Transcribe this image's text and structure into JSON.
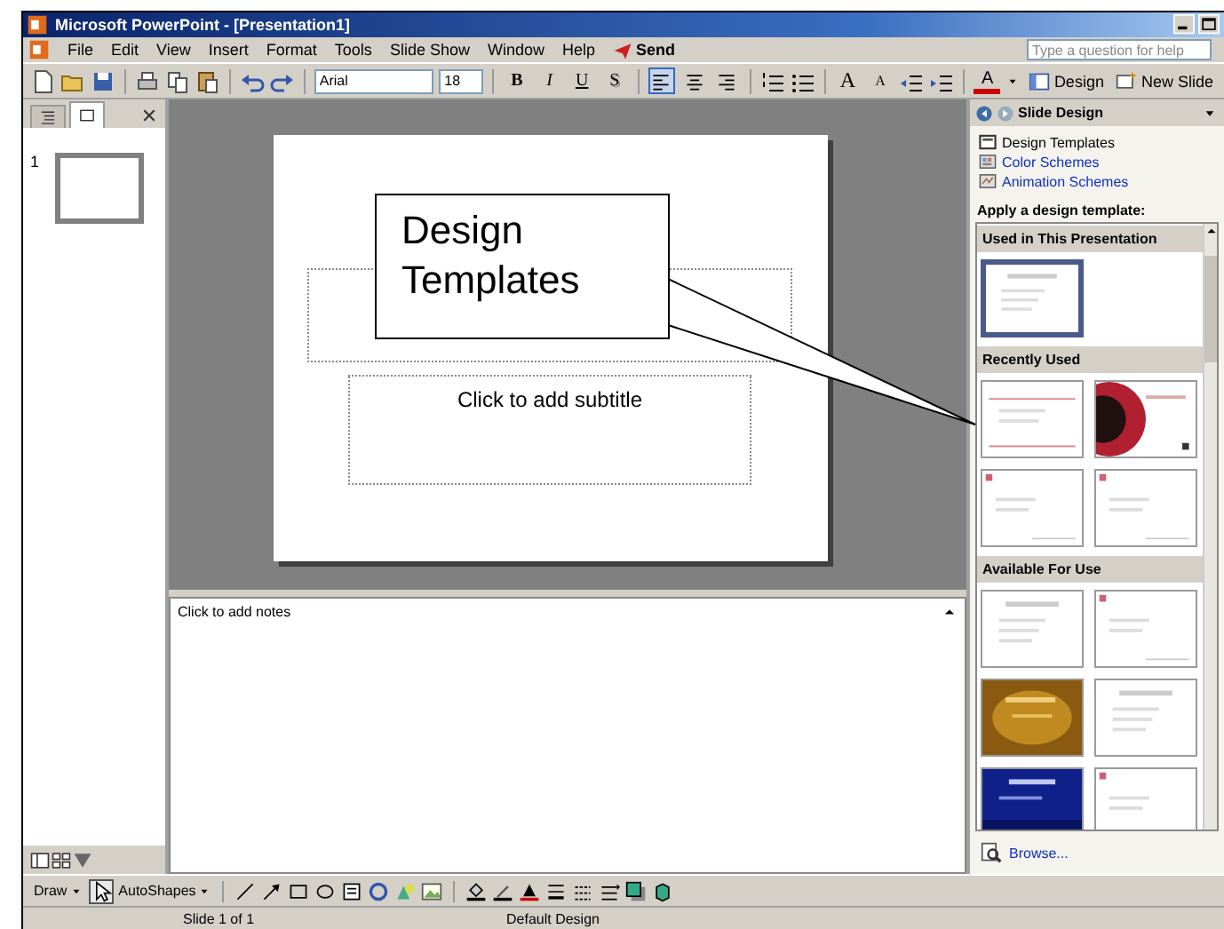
{
  "window": {
    "title": "Microsoft PowerPoint - [Presentation1]"
  },
  "menu": {
    "items": [
      "File",
      "Edit",
      "View",
      "Insert",
      "Format",
      "Tools",
      "Slide Show",
      "Window",
      "Help"
    ],
    "send": "Send",
    "help_box": {
      "placeholder": "Type a question for help"
    }
  },
  "toolbar": {
    "font": "Arial",
    "size": "18",
    "format_buttons": [
      {
        "label": "B",
        "kind": "bold"
      },
      {
        "label": "I",
        "kind": "italic"
      },
      {
        "label": "U",
        "kind": "underline"
      },
      {
        "label": "S",
        "kind": "shadow"
      }
    ],
    "align": [
      {
        "kind": "left",
        "selected": true
      },
      {
        "kind": "center",
        "selected": false
      },
      {
        "kind": "right",
        "selected": false
      }
    ],
    "size_buttons": [
      {
        "label": "A",
        "kind": "grow"
      },
      {
        "label": "A",
        "kind": "shrink"
      }
    ],
    "font_color": "A",
    "design_button": "Design",
    "new_slide_button": "New Slide"
  },
  "slides_pane": {
    "tabs": [
      {
        "kind": "outline",
        "selected": false
      },
      {
        "kind": "slides",
        "selected": true
      }
    ],
    "slides": [
      {
        "number": "1",
        "selected": true
      }
    ]
  },
  "slide": {
    "subtitle_placeholder": "Click to add subtitle"
  },
  "notes": {
    "text": "Click to add notes"
  },
  "task_pane": {
    "title": "Slide Design",
    "links": [
      {
        "label": "Design Templates",
        "selected": true
      },
      {
        "label": "Color Schemes",
        "selected": false
      },
      {
        "label": "Animation Schemes",
        "selected": false
      }
    ],
    "apply_label": "Apply a design template:",
    "sections": [
      {
        "title": "Used in This Presentation",
        "templates": [
          {
            "kind": "plain",
            "selected": true
          }
        ]
      },
      {
        "title": "Recently Used",
        "templates": [
          {
            "kind": "lines",
            "selected": false
          },
          {
            "kind": "circle",
            "selected": false
          },
          {
            "kind": "corner",
            "selected": false
          },
          {
            "kind": "corner",
            "selected": false
          }
        ]
      },
      {
        "title": "Available For Use",
        "templates": [
          {
            "kind": "plain",
            "selected": false
          },
          {
            "kind": "corner",
            "selected": false
          },
          {
            "kind": "gold",
            "selected": false
          },
          {
            "kind": "plain",
            "selected": false
          },
          {
            "kind": "navy",
            "selected": false
          },
          {
            "kind": "corner",
            "selected": false
          }
        ]
      }
    ],
    "browse": "Browse..."
  },
  "draw_toolbar": {
    "draw": "Draw",
    "autoshapes": "AutoShapes"
  },
  "status_bar": {
    "slide": "Slide 1 of 1",
    "design": "Default Design"
  },
  "callout": {
    "text": "Design Templates"
  }
}
